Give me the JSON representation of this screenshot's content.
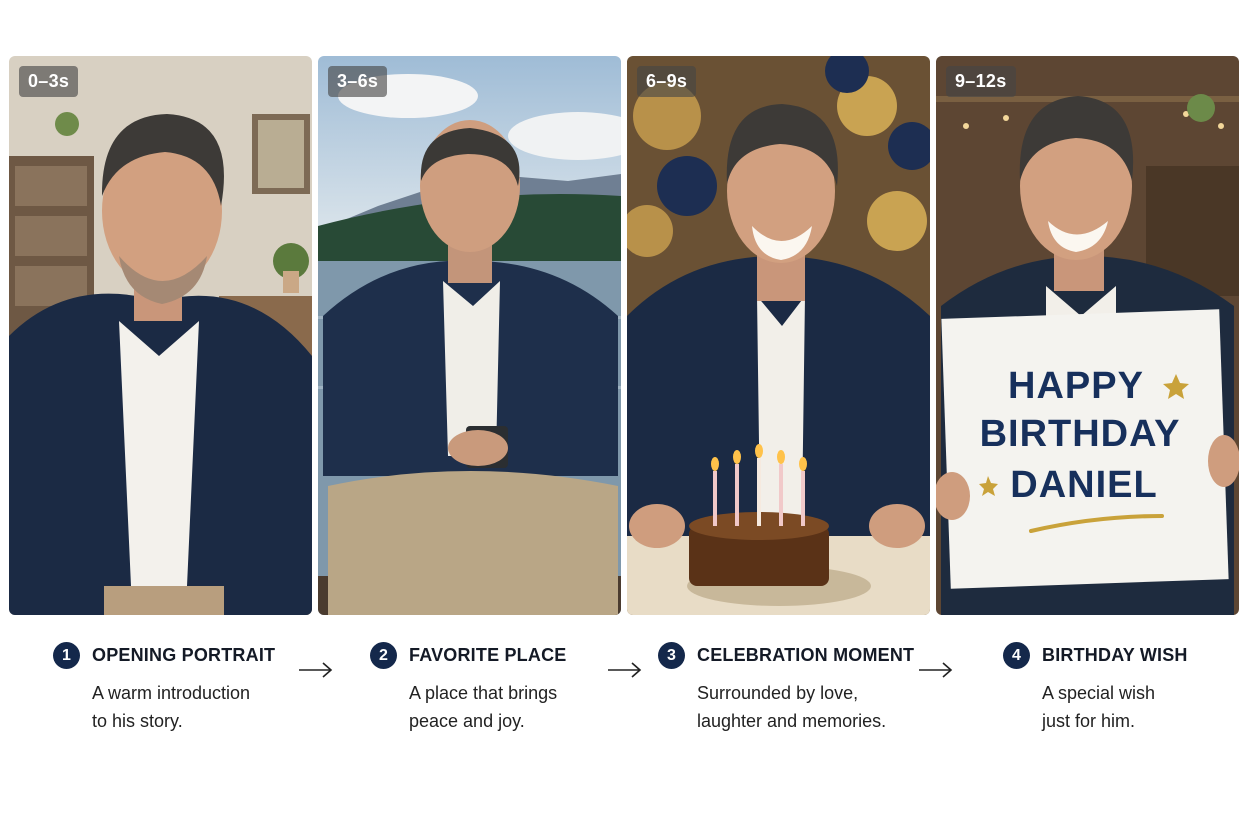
{
  "panels": [
    {
      "badge": "0–3s",
      "number": "1",
      "title": "OPENING PORTRAIT",
      "description": "A warm introduction\nto his story."
    },
    {
      "badge": "3–6s",
      "number": "2",
      "title": "FAVORITE PLACE",
      "description": "A place that brings\npeace and joy."
    },
    {
      "badge": "6–9s",
      "number": "3",
      "title": "CELEBRATION MOMENT",
      "description": "Surrounded by love,\nlaughter and memories."
    },
    {
      "badge": "9–12s",
      "number": "4",
      "title": "BIRTHDAY WISH",
      "description": "A special wish\njust for him."
    }
  ],
  "sign": {
    "line1": "HAPPY",
    "line2": "BIRTHDAY",
    "line3": "DANIEL"
  },
  "colors": {
    "badge_bg": "#14284b",
    "shirt": "#1b2a44",
    "sign_text": "#17305c",
    "gold": "#c9a23a"
  },
  "icons": {
    "arrow": "right-arrow-icon"
  }
}
